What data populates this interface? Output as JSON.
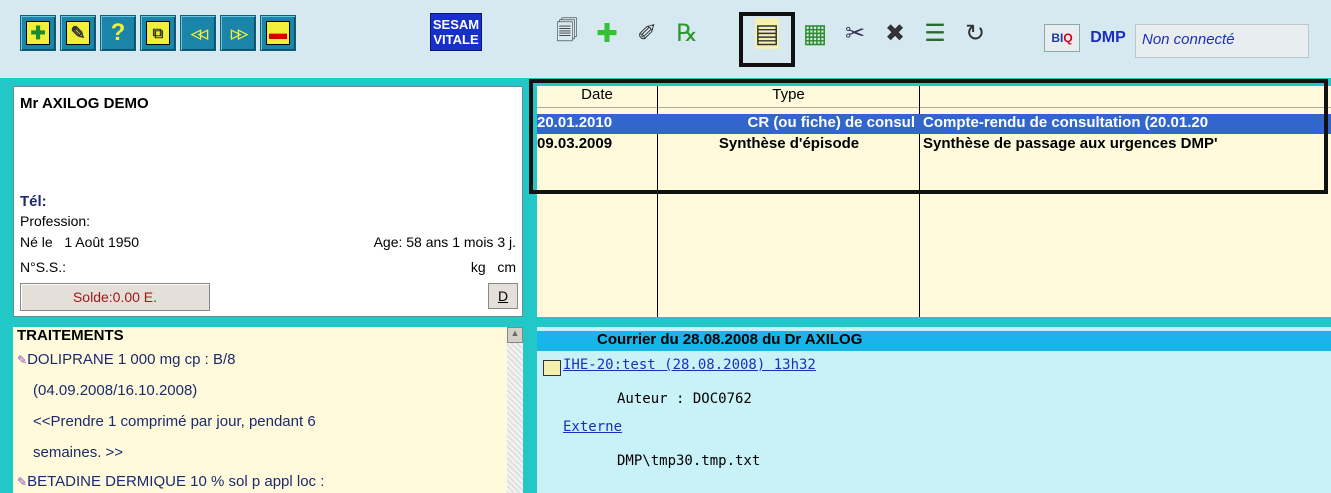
{
  "toolbar": {
    "left_buttons": [
      "add-patient-icon",
      "edit-icon",
      "help-icon",
      "copy-icon",
      "previous-icon",
      "next-icon",
      "remove-icon"
    ],
    "left_glyphs": [
      "✚",
      "✎",
      "?",
      "⧉",
      "◁◁",
      "▷▷",
      "▬"
    ],
    "sesam_line1": "SESAM",
    "sesam_line2": "VITALE",
    "right_buttons": [
      "folder-icon",
      "add-icon",
      "pen-icon",
      "prescription-icon",
      "document-icon",
      "calculator-icon",
      "syringe-icon",
      "tools-icon",
      "table-icon",
      "refresh-icon"
    ],
    "right_glyphs": [
      "🗐",
      "✚",
      "✐",
      "℞",
      "▤",
      "▦",
      "✂",
      "✖",
      "☰",
      "↻"
    ],
    "biq_b": "BI",
    "biq_q": "Q",
    "dmp_label": "DMP",
    "dmp_status": "Non connecté"
  },
  "patient": {
    "name": "Mr AXILOG DEMO",
    "tel_label": "Tél:",
    "profession_label": "Profession:",
    "birth": "Né le   1 Août 1950",
    "age": "Age: 58 ans 1 mois 3 j.",
    "nss_label": "N°S.S.:",
    "weight_height": "kg   cm",
    "solde": "Solde:0.00 E.",
    "d_button": "D"
  },
  "documents": {
    "headers": [
      "Date",
      "Type",
      ""
    ],
    "rows": [
      {
        "date": "20.01.2010",
        "type": "CR (ou fiche) de consul",
        "title": "Compte-rendu de consultation  (20.01.20"
      },
      {
        "date": "09.03.2009",
        "type": "Synthèse d'épisode",
        "title": "Synthèse de passage aux urgences DMP'"
      }
    ]
  },
  "traitements": {
    "title": "TRAITEMENTS",
    "lines": [
      "DOLIPRANE 1 000 mg cp : B/8",
      "(04.09.2008/16.10.2008)",
      "<<Prendre 1 comprimé par jour, pendant 6",
      "semaines. >>",
      "BETADINE DERMIQUE 10 % sol p appl loc :"
    ]
  },
  "courrier": {
    "header": "Courrier du 28.08.2008 du Dr AXILOG",
    "link": "IHE-20:test   (28.08.2008) 13h32",
    "auteur": "Auteur : DOC0762",
    "externe": "Externe",
    "path": "DMP\\tmp30.tmp.txt"
  }
}
